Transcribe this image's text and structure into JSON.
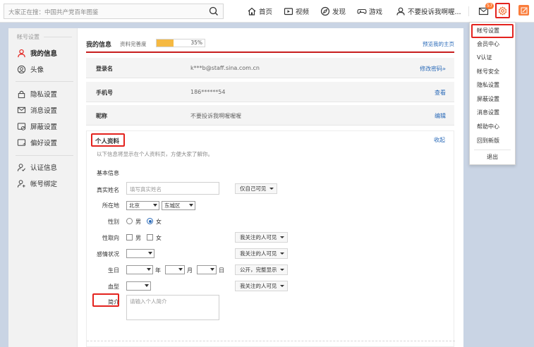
{
  "topbar": {
    "search_placeholder": "大家正在搜：中国共产党百年图鉴",
    "nav": [
      {
        "label": "首页",
        "icon": "home-icon"
      },
      {
        "label": "视频",
        "icon": "video-icon"
      },
      {
        "label": "发现",
        "icon": "compass-icon"
      },
      {
        "label": "游戏",
        "icon": "gamepad-icon"
      },
      {
        "label": "不要投诉我啊喔...",
        "icon": "user-icon"
      }
    ],
    "mail_badge": "57"
  },
  "sidebar": {
    "section_title": "帐号设置",
    "items": [
      {
        "label": "我的信息",
        "icon": "user-icon"
      },
      {
        "label": "头像",
        "icon": "avatar-icon"
      },
      {
        "label": "隐私设置",
        "icon": "lock-icon"
      },
      {
        "label": "消息设置",
        "icon": "message-icon"
      },
      {
        "label": "屏蔽设置",
        "icon": "block-icon"
      },
      {
        "label": "偏好设置",
        "icon": "preference-icon"
      },
      {
        "label": "认证信息",
        "icon": "verify-icon"
      },
      {
        "label": "帐号绑定",
        "icon": "bind-icon"
      }
    ]
  },
  "info": {
    "title": "我的信息",
    "progress_label": "资料完善度",
    "progress_text": "35%",
    "progress_value": 0.35,
    "preview_link": "预览我的主页"
  },
  "rows": [
    {
      "label": "登录名",
      "value": "k***b@staff.sina.com.cn",
      "link": "修改密码»"
    },
    {
      "label": "手机号",
      "value": "186******54",
      "link": "查看"
    },
    {
      "label": "昵称",
      "value": "不要投诉我啊喔喔喔",
      "link": "编辑"
    }
  ],
  "personal": {
    "title": "个人资料",
    "collapse": "收起",
    "desc": "以下信息将显示在个人资料页，方便大家了解你。",
    "basic_title": "基本信息",
    "real_name_label": "真实姓名",
    "real_name_placeholder": "填写真实姓名",
    "real_name_privacy": "仅自己可见",
    "location_label": "所在地",
    "province": "北京",
    "district": "东城区",
    "gender_label": "性别",
    "male": "男",
    "female": "女",
    "orientation_label": "性取向",
    "orientation_male": "男",
    "orientation_female": "女",
    "orientation_privacy": "我关注的人可见",
    "relationship_label": "感情状况",
    "relationship_privacy": "我关注的人可见",
    "birthday_label": "生日",
    "year": "年",
    "month": "月",
    "day": "日",
    "birthday_privacy": "公开，完整显示",
    "blood_label": "血型",
    "blood_privacy": "我关注的人可见",
    "intro_label": "简介",
    "intro_placeholder": "请输入个人简介"
  },
  "menu": {
    "items": [
      "帐号设置",
      "会员中心",
      "V认证",
      "帐号安全",
      "隐私设置",
      "屏蔽设置",
      "消息设置",
      "帮助中心",
      "回到新版"
    ],
    "logout": "退出"
  }
}
